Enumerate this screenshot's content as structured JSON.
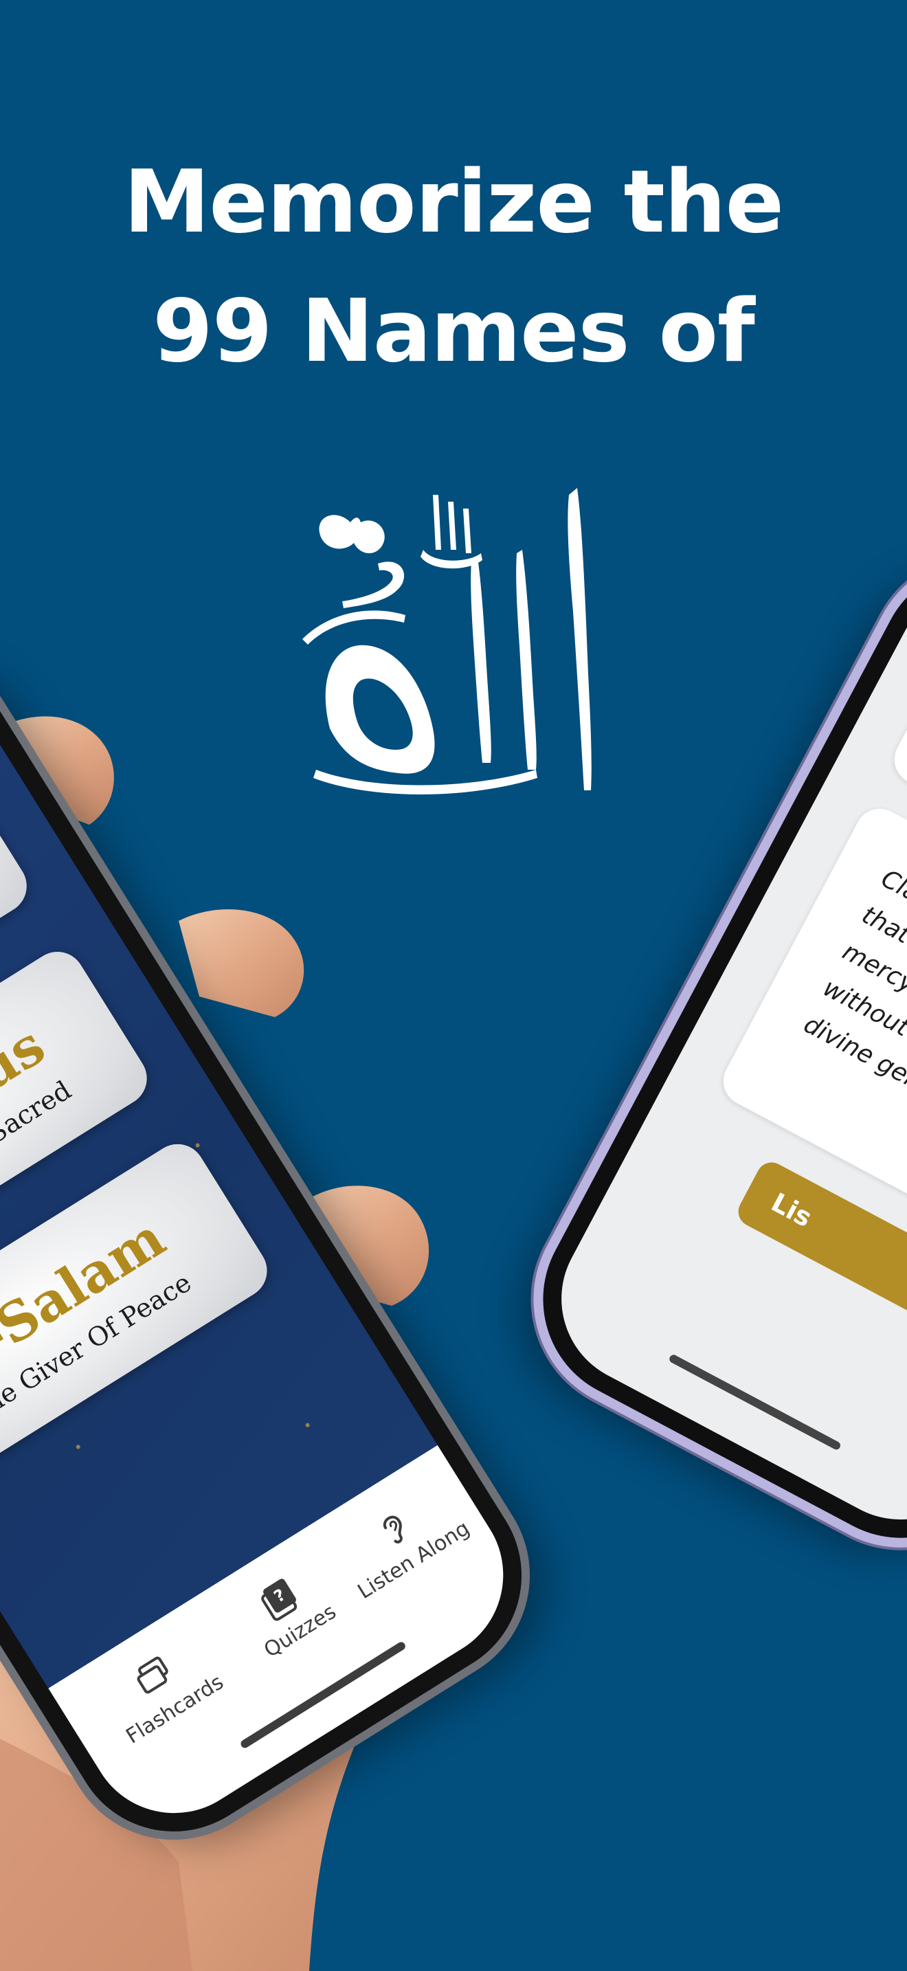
{
  "headline": {
    "line1": "Memorize the",
    "line2": "99 Names of"
  },
  "icons": {
    "calligraphy": "allah-calligraphy-icon",
    "flashcards": "flashcards-icon",
    "quizzes": "quiz-icon",
    "listen": "hearing-icon"
  },
  "left_phone": {
    "cards": [
      {
        "name": "",
        "meaning": ""
      },
      {
        "name": "uddus",
        "meaning": "ost Sacred"
      },
      {
        "name": "As-Salam",
        "meaning": "The Giver Of Peace"
      }
    ],
    "tabs": {
      "flashcards": "Flashcards",
      "quizzes": "Quizzes",
      "listen_along": "Listen Along"
    }
  },
  "right_phone": {
    "lines": [
      "Classi",
      "that Ar-",
      "mercy th",
      "without li",
      "divine gene"
    ],
    "button_label": "Lis"
  },
  "colors": {
    "background": "#024e7d",
    "gold": "#b08a1e",
    "app_navy": "#1f3f7a",
    "phone_lavender": "#b9b4e0"
  }
}
